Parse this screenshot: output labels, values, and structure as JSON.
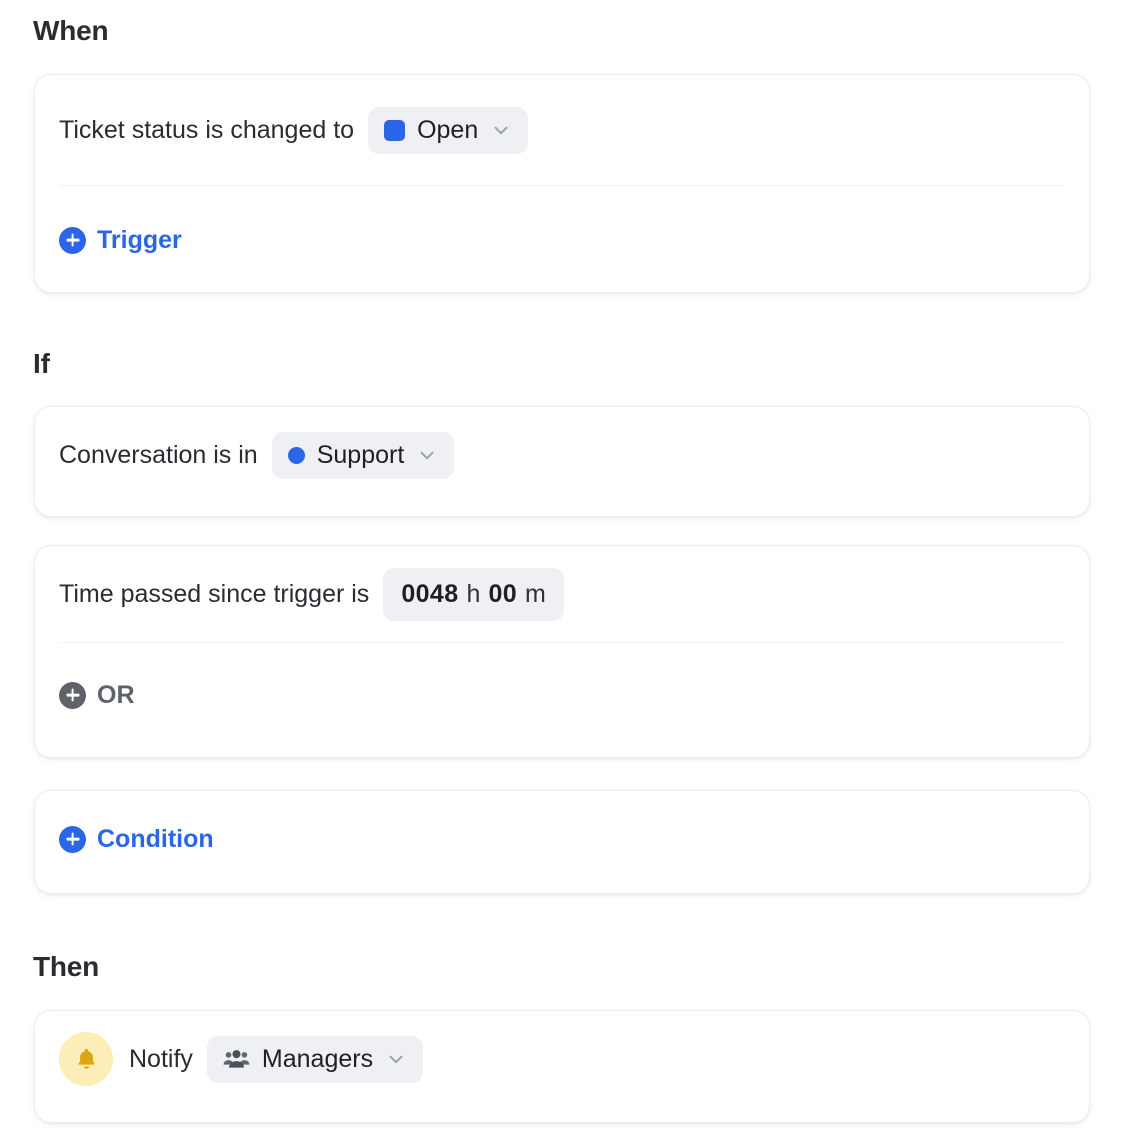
{
  "sections": {
    "when": {
      "heading": "When",
      "trigger_row": {
        "label": "Ticket status is changed to",
        "value": "Open",
        "swatch_color": "#2b65e8",
        "chevron_icon": "chevron-down-icon"
      },
      "add_trigger": {
        "label": "Trigger",
        "icon": "plus-circle-icon",
        "color": "#2b65e8"
      }
    },
    "if": {
      "heading": "If",
      "condition_1": {
        "label": "Conversation is in",
        "value": "Support",
        "dot_color": "#2b65e8",
        "chevron_icon": "chevron-down-icon"
      },
      "condition_2": {
        "label": "Time passed since trigger is",
        "hours": "0048",
        "hours_unit": "h",
        "minutes": "00",
        "minutes_unit": "m"
      },
      "add_or": {
        "label": "OR",
        "icon": "plus-circle-icon",
        "color": "#5f6269"
      },
      "add_condition": {
        "label": "Condition",
        "icon": "plus-circle-icon",
        "color": "#2b65e8"
      }
    },
    "then": {
      "heading": "Then",
      "action_row": {
        "avatar_icon": "bell-icon",
        "avatar_bg": "#fdeeb8",
        "avatar_fg": "#dba612",
        "label": "Notify",
        "value": "Managers",
        "value_icon": "people-group-icon",
        "chevron_icon": "chevron-down-icon"
      }
    }
  },
  "theme": {
    "accent": "#2b65e8",
    "pill_bg": "#eff0f3",
    "card_bg": "#ffffff",
    "card_border": "#ebecef",
    "text": "#2b2b31",
    "muted": "#5f6269"
  }
}
